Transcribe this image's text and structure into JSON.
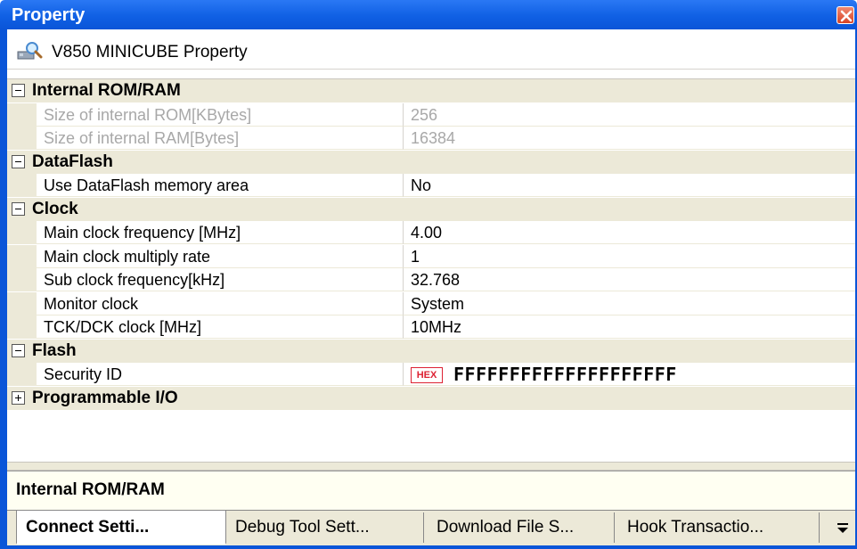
{
  "window": {
    "title": "Property",
    "close_icon": "close-icon"
  },
  "header": {
    "icon": "property-icon",
    "text": "V850 MINICUBE Property"
  },
  "categories": [
    {
      "label": "Internal ROM/RAM",
      "expanded": true,
      "props": [
        {
          "name": "Size of internal ROM[KBytes]",
          "value": "256",
          "disabled": true
        },
        {
          "name": "Size of internal RAM[Bytes]",
          "value": "16384",
          "disabled": true
        }
      ]
    },
    {
      "label": "DataFlash",
      "expanded": true,
      "props": [
        {
          "name": "Use DataFlash memory area",
          "value": "No"
        }
      ]
    },
    {
      "label": "Clock",
      "expanded": true,
      "props": [
        {
          "name": "Main clock frequency [MHz]",
          "value": "4.00"
        },
        {
          "name": "Main clock multiply rate",
          "value": "1"
        },
        {
          "name": "Sub clock frequency[kHz]",
          "value": "32.768"
        },
        {
          "name": "Monitor clock",
          "value": "System"
        },
        {
          "name": "TCK/DCK clock [MHz]",
          "value": "10MHz"
        }
      ]
    },
    {
      "label": "Flash",
      "expanded": true,
      "props": [
        {
          "name": "Security ID",
          "badge": "HEX",
          "value": "FFFFFFFFFFFFFFFFFFFF"
        }
      ]
    },
    {
      "label": "Programmable I/O",
      "expanded": false,
      "props": []
    }
  ],
  "description": {
    "text": "Internal ROM/RAM"
  },
  "tabs": [
    {
      "label": "Connect Setti...",
      "active": true
    },
    {
      "label": "Debug Tool Sett..."
    },
    {
      "label": "Download File S..."
    },
    {
      "label": "Hook Transactio..."
    }
  ],
  "tab_overflow_icon": "chevron-down-icon"
}
